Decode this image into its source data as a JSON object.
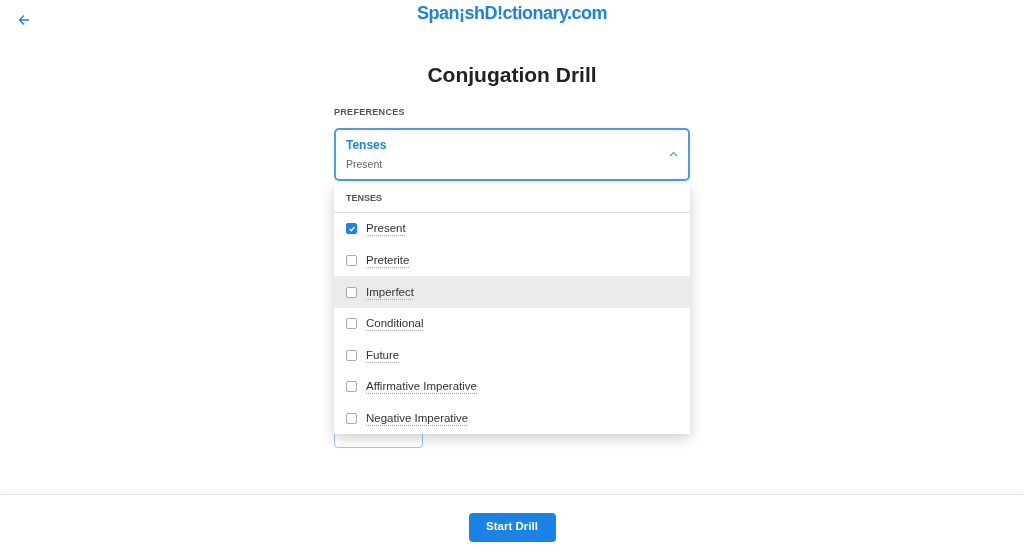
{
  "header": {
    "logo": "Span¡shD!ctionary.com"
  },
  "title": "Conjugation Drill",
  "section_label": "PREFERENCES",
  "select": {
    "label": "Tenses",
    "value": "Present",
    "expanded": true
  },
  "menu": {
    "heading": "TENSES",
    "items": [
      {
        "label": "Present",
        "checked": true,
        "highlighted": false
      },
      {
        "label": "Preterite",
        "checked": false,
        "highlighted": false
      },
      {
        "label": "Imperfect",
        "checked": false,
        "highlighted": true
      },
      {
        "label": "Conditional",
        "checked": false,
        "highlighted": false
      },
      {
        "label": "Future",
        "checked": false,
        "highlighted": false
      },
      {
        "label": "Affirmative Imperative",
        "checked": false,
        "highlighted": false
      },
      {
        "label": "Negative Imperative",
        "checked": false,
        "highlighted": false
      }
    ]
  },
  "footer": {
    "button": "Start Drill"
  }
}
